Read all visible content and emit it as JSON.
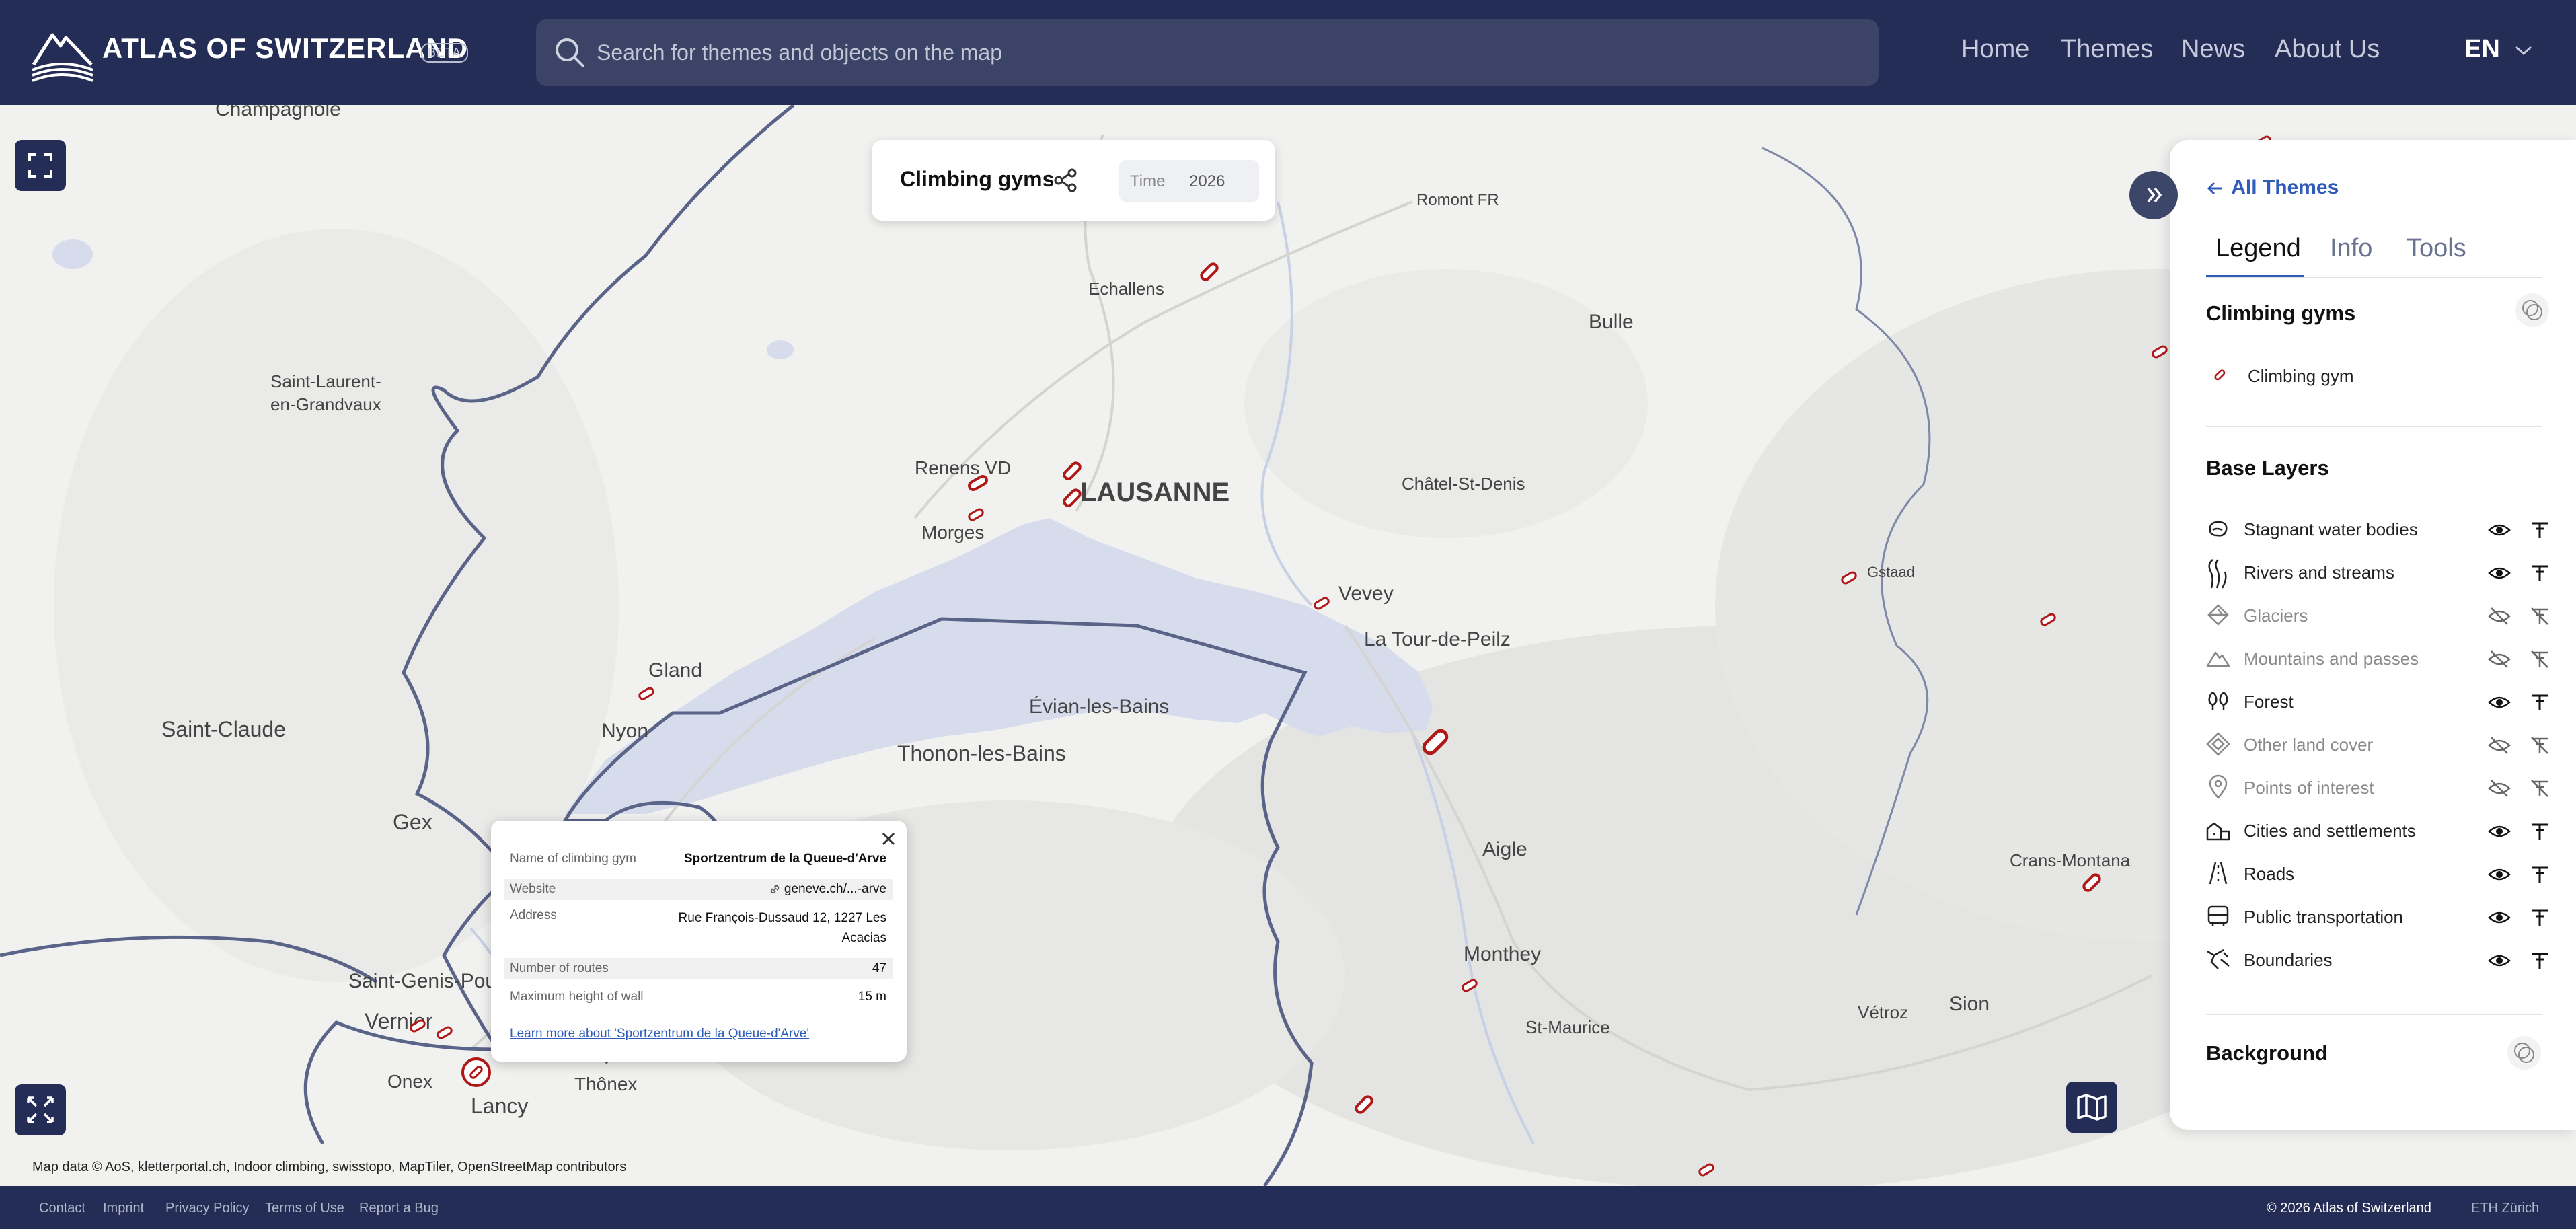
{
  "header": {
    "brand": "ATLAS OF SWITZERLAND",
    "badge": "BETA",
    "search_placeholder": "Search for themes and objects on the map",
    "nav": [
      "Home",
      "Themes",
      "News",
      "About Us"
    ],
    "language": "EN"
  },
  "theme_card": {
    "title": "Climbing gyms",
    "time_label": "Time",
    "time_value": "2026"
  },
  "map": {
    "places": [
      "Champagnole",
      "Romont FR",
      "Echallens",
      "Bulle",
      "Saint-Laurent-",
      "en-Grandvaux",
      "Renens VD",
      "LAUSANNE",
      "Châtel-St-Denis",
      "Morges",
      "Gstaad",
      "Vevey",
      "La Tour-de-Peilz",
      "Gland",
      "Évian-les-Bains",
      "Saint-Claude",
      "Nyon",
      "Thonon-les-Bains",
      "Gex",
      "Aigle",
      "Crans-Montana",
      "Saint-Genis-Pou",
      "Vernier",
      "Monthey",
      "Vétroz",
      "Sion",
      "St-Maurice",
      "Onex",
      "Thônex",
      "Lancy"
    ],
    "attribution": "Map data © AoS, kletterportal.ch, Indoor climbing, swisstopo, MapTiler, OpenStreetMap contributors"
  },
  "popup": {
    "rows": [
      {
        "key": "Name of climbing gym",
        "value": "Sportzentrum de la Queue-d'Arve"
      },
      {
        "key": "Website",
        "value": "geneve.ch/...-arve"
      },
      {
        "key": "Address",
        "value": "Rue François-Dussaud 12, 1227 Les",
        "value2": "Acacias"
      },
      {
        "key": "Number of routes",
        "value": "47"
      },
      {
        "key": "Maximum height of wall",
        "value": "15 m"
      }
    ],
    "link": "Learn more about 'Sportzentrum de la Queue-d'Arve'"
  },
  "panel": {
    "back": "All Themes",
    "tabs": [
      "Legend",
      "Info",
      "Tools"
    ],
    "theme_heading": "Climbing gyms",
    "legend_item": "Climbing gym",
    "base_layers_heading": "Base Layers",
    "layers": [
      {
        "label": "Stagnant water bodies",
        "visible": true
      },
      {
        "label": "Rivers and streams",
        "visible": true
      },
      {
        "label": "Glaciers",
        "visible": false
      },
      {
        "label": "Mountains and passes",
        "visible": false
      },
      {
        "label": "Forest",
        "visible": true
      },
      {
        "label": "Other land cover",
        "visible": false
      },
      {
        "label": "Points of interest",
        "visible": false
      },
      {
        "label": "Cities and settlements",
        "visible": true
      },
      {
        "label": "Roads",
        "visible": true
      },
      {
        "label": "Public transportation",
        "visible": true
      },
      {
        "label": "Boundaries",
        "visible": true
      }
    ],
    "background_heading": "Background"
  },
  "footer": {
    "links": [
      "Contact",
      "Imprint",
      "Privacy Policy",
      "Terms of Use",
      "Report a Bug"
    ],
    "copyright": "© 2026 Atlas of Switzerland",
    "eth": "ETH Zürich"
  },
  "colors": {
    "header_bg": "#232d55",
    "accent": "#2e5cb8",
    "marker": "#b01818",
    "lake": "#d6dcec"
  }
}
